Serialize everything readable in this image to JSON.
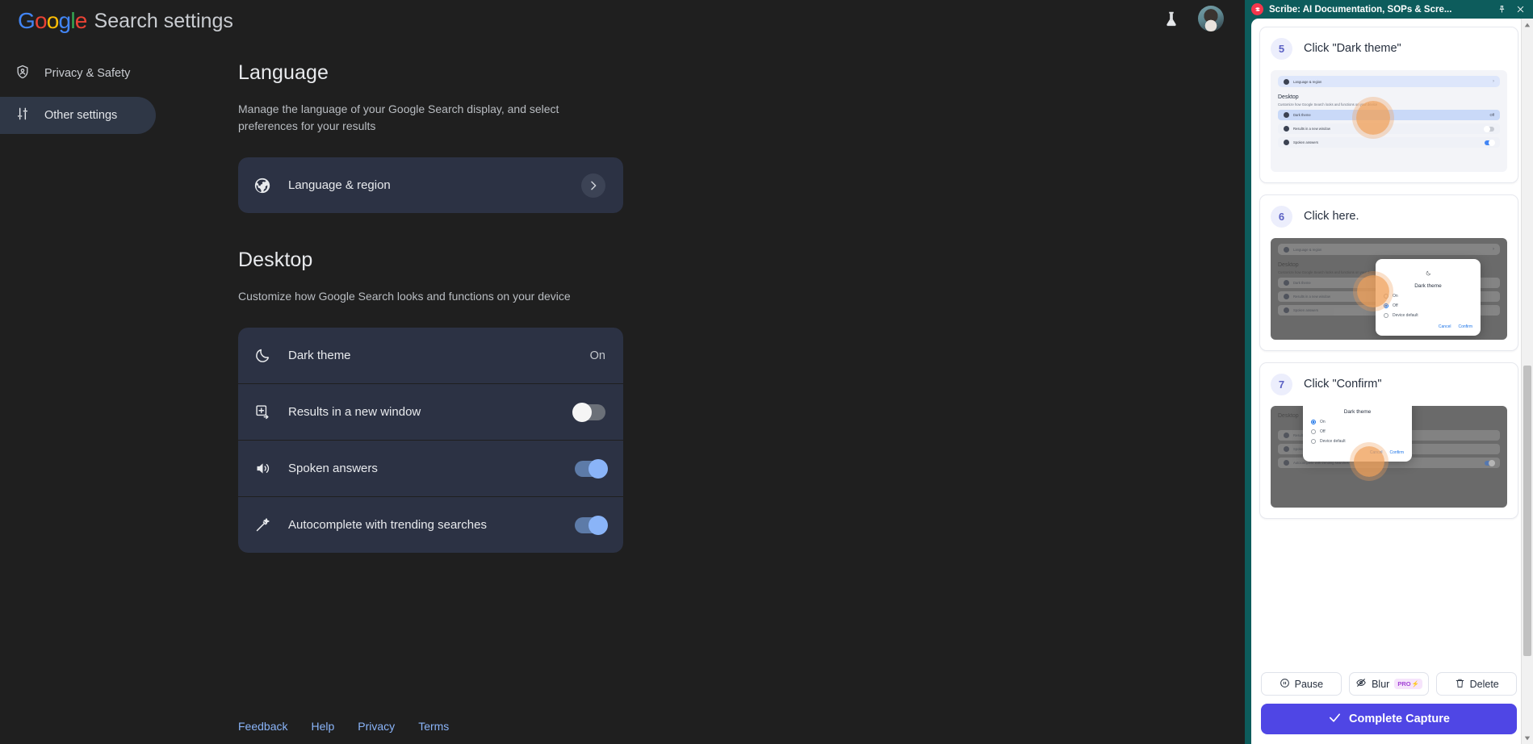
{
  "google": {
    "logo_text": "Google",
    "title": "Search settings",
    "header_icons": {
      "labs": "labs-flask-icon",
      "avatar": "user-avatar"
    },
    "nav": [
      {
        "label": "Privacy & Safety",
        "icon": "shield-person-icon",
        "active": false
      },
      {
        "label": "Other settings",
        "icon": "tune-sliders-icon",
        "active": true
      }
    ],
    "sections": [
      {
        "title": "Language",
        "description": "Manage the language of your Google Search display, and select preferences for your results",
        "rows": [
          {
            "label": "Language & region",
            "icon": "globe-icon",
            "control": "chevron",
            "value": ""
          }
        ]
      },
      {
        "title": "Desktop",
        "description": "Customize how Google Search looks and functions on your device",
        "rows": [
          {
            "label": "Dark theme",
            "icon": "moon-icon",
            "control": "value",
            "value": "On"
          },
          {
            "label": "Results in a new window",
            "icon": "open-in-new-icon",
            "control": "toggle",
            "toggle": "off"
          },
          {
            "label": "Spoken answers",
            "icon": "volume-up-icon",
            "control": "toggle",
            "toggle": "on"
          },
          {
            "label": "Autocomplete with trending searches",
            "icon": "magic-wand-icon",
            "control": "toggle",
            "toggle": "on"
          }
        ]
      }
    ],
    "footer_links": [
      "Feedback",
      "Help",
      "Privacy",
      "Terms"
    ]
  },
  "scribe": {
    "window_title": "Scribe: AI Documentation, SOPs & Scre...",
    "logo_icon": "scribe-logo-icon",
    "pin_icon": "pin-icon",
    "close_icon": "close-icon",
    "steps": [
      {
        "number": "5",
        "text": "Click \"Dark theme\"",
        "thumb": "light-settings-page-dark-theme-row-highlighted"
      },
      {
        "number": "6",
        "text": "Click here.",
        "thumb": "dark-theme-dialog-on-option"
      },
      {
        "number": "7",
        "text": "Click \"Confirm\"",
        "thumb": "dark-theme-dialog-confirm-button"
      }
    ],
    "thumb_mini": {
      "language_row": "Language & region",
      "heading": "Desktop",
      "subtext": "Customize how Google Search looks and functions on your device",
      "rows": [
        "Dark theme",
        "Results in a new window",
        "Spoken answers",
        "Autocomplete with trending searches"
      ],
      "dark_theme_value": "Off",
      "dialog_title": "Dark theme",
      "dialog_options": [
        "On",
        "Off",
        "Device default"
      ],
      "dialog_cancel": "Cancel",
      "dialog_confirm": "Confirm"
    },
    "tools": [
      {
        "label": "Pause",
        "icon": "pause-circle-icon",
        "badge": ""
      },
      {
        "label": "Blur",
        "icon": "eye-off-icon",
        "badge": "PRO"
      },
      {
        "label": "Delete",
        "icon": "trash-icon",
        "badge": ""
      }
    ],
    "complete_button": {
      "label": "Complete Capture",
      "icon": "check-icon"
    },
    "colors": {
      "panel_bg": "#0d5c5c",
      "primary": "#4f46e5",
      "step_num": "#5b61c4",
      "pro_badge": "#a243d6"
    }
  }
}
